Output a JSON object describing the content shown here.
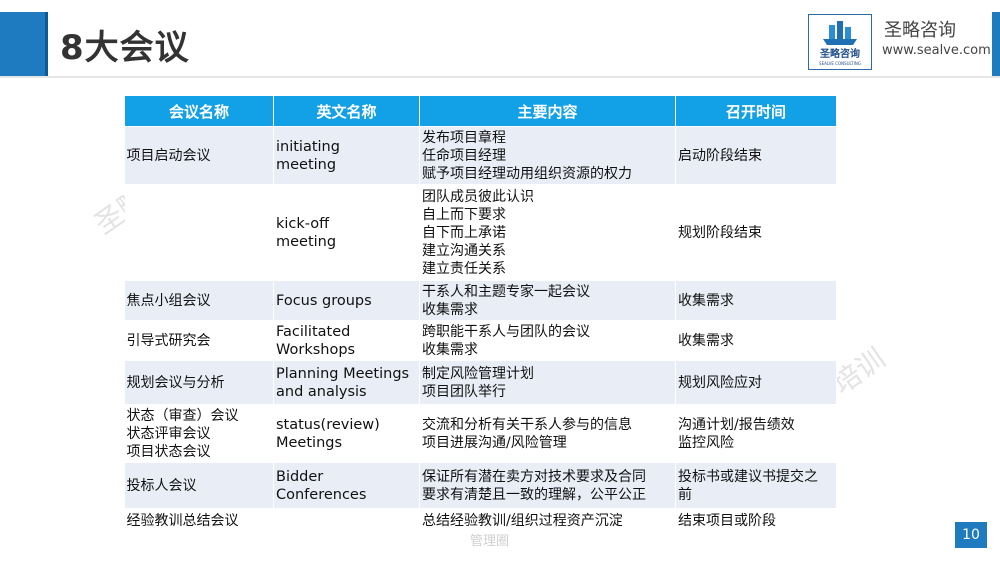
{
  "slide": {
    "title": "8大会议",
    "page_number": "10"
  },
  "logo": {
    "badge_text": "圣略咨询",
    "badge_subtext": "SEALVE CONSULTING",
    "name": "圣略咨询",
    "url": "www.sealve.com"
  },
  "watermarks": {
    "left": "圣略",
    "right": "培训",
    "bottom": "管理圈"
  },
  "table": {
    "headers": [
      "会议名称",
      "英文名称",
      "主要内容",
      "召开时间"
    ],
    "rows": [
      [
        "项目启动会议",
        "initiating\nmeeting",
        "发布项目章程\n任命项目经理\n赋予项目经理动用组织资源的权力",
        "启动阶段结束"
      ],
      [
        "",
        "kick-off\nmeeting",
        "团队成员彼此认识\n自上而下要求\n自下而上承诺\n建立沟通关系\n建立责任关系",
        "规划阶段结束"
      ],
      [
        "焦点小组会议",
        "Focus groups",
        "干系人和主题专家一起会议\n收集需求",
        "收集需求"
      ],
      [
        "引导式研究会",
        "Facilitated\nWorkshops",
        "跨职能干系人与团队的会议\n收集需求",
        "收集需求"
      ],
      [
        "规划会议与分析",
        "Planning Meetings\nand analysis",
        "制定风险管理计划\n项目团队举行",
        "规划风险应对"
      ],
      [
        "状态（审查）会议\n状态评审会议\n项目状态会议",
        "status(review)\nMeetings",
        "交流和分析有关干系人参与的信息\n项目进展沟通/风险管理",
        "沟通计划/报告绩效\n监控风险"
      ],
      [
        "投标人会议",
        "Bidder\nConferences",
        "保证所有潜在卖方对技术要求及合同\n要求有清楚且一致的理解，公平公正",
        "投标书或建议书提交之\n前"
      ],
      [
        "经验教训总结会议",
        "",
        "总结经验教训/组织过程资产沉淀",
        "结束项目或阶段"
      ]
    ]
  },
  "colors": {
    "accent_blue": "#1f7bc0",
    "header_blue": "#12a0e6",
    "row_shade": "#e9eef6"
  }
}
